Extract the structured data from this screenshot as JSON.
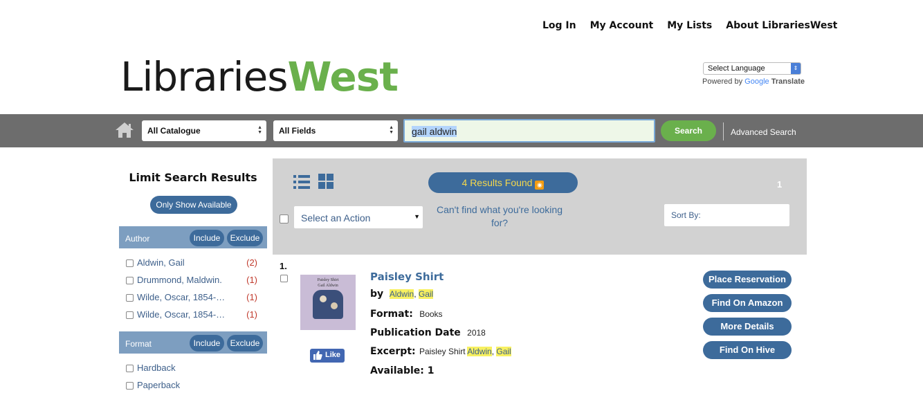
{
  "topnav": {
    "login": "Log In",
    "account": "My Account",
    "lists": "My Lists",
    "about": "About LibrariesWest"
  },
  "logo": {
    "part1": "Libraries",
    "part2": "West"
  },
  "translate": {
    "select_label": "Select Language",
    "powered_by": "Powered by",
    "google": "Google",
    "translate": "Translate"
  },
  "search": {
    "catalogue": "All Catalogue",
    "fields": "All Fields",
    "query": "gail aldwin",
    "button": "Search",
    "advanced": "Advanced Search"
  },
  "sidebar": {
    "title": "Limit Search Results",
    "only_available": "Only Show Available",
    "include": "Include",
    "exclude": "Exclude",
    "facets": [
      {
        "name": "Author",
        "items": [
          {
            "label": "Aldwin, Gail",
            "count": "(2)"
          },
          {
            "label": "Drummond, Maldwin.",
            "count": "(1)"
          },
          {
            "label": "Wilde, Oscar, 1854-…",
            "count": "(1)"
          },
          {
            "label": "Wilde, Oscar, 1854-…",
            "count": "(1)"
          }
        ]
      },
      {
        "name": "Format",
        "items": [
          {
            "label": "Hardback",
            "count": ""
          },
          {
            "label": "Paperback",
            "count": ""
          }
        ]
      }
    ]
  },
  "results": {
    "found": "4 Results Found",
    "page": "1",
    "action_select": "Select an Action",
    "cant_find": "Can't find what you're looking for?",
    "sort_by": "Sort By:"
  },
  "item": {
    "number": "1.",
    "cover_title": "Paisley Shirt",
    "cover_author": "Gail Aldwin",
    "like": "Like",
    "title": "Paisley Shirt",
    "by_label": "by",
    "author_last": "Aldwin",
    "author_sep": ",",
    "author_first": "Gail",
    "format_label": "Format:",
    "format": "Books",
    "pubdate_label": "Publication Date",
    "pubdate": "2018",
    "excerpt_label": "Excerpt:",
    "excerpt_text": "Paisley Shirt",
    "available": "Available: 1",
    "buttons": {
      "reserve": "Place Reservation",
      "amazon": "Find On Amazon",
      "details": "More Details",
      "hive": "Find On Hive"
    }
  },
  "colors": {
    "brand_green": "#6ab04c",
    "brand_blue": "#3d6b9b",
    "highlight": "#f7f060",
    "count_red": "#c0392b"
  }
}
